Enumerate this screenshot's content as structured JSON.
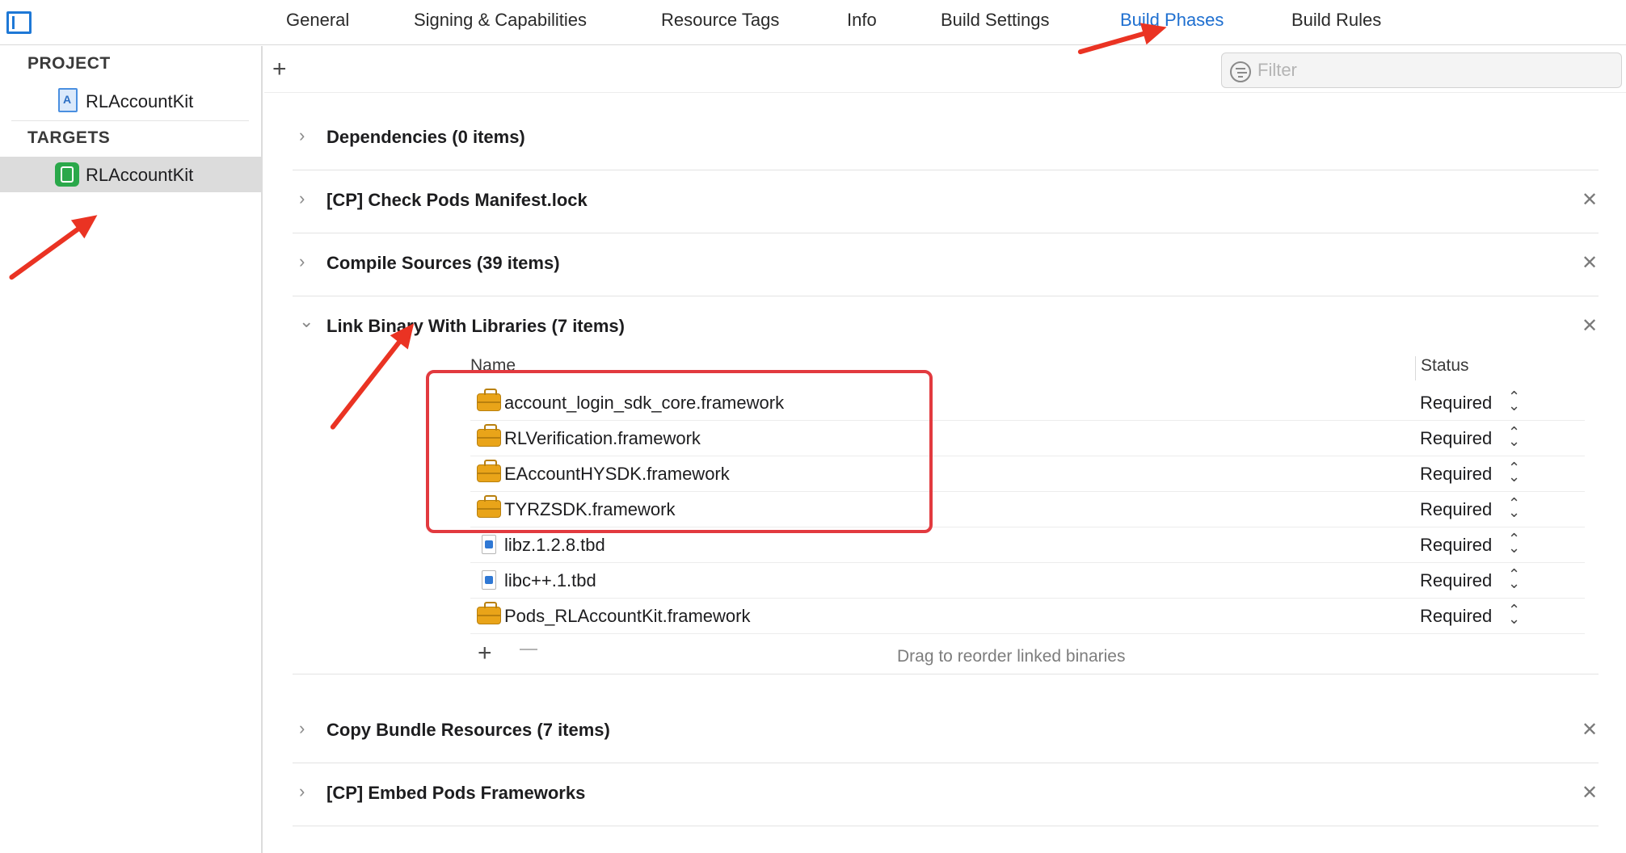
{
  "tabs": [
    {
      "label": "General",
      "active": false
    },
    {
      "label": "Signing & Capabilities",
      "active": false
    },
    {
      "label": "Resource Tags",
      "active": false
    },
    {
      "label": "Info",
      "active": false
    },
    {
      "label": "Build Settings",
      "active": false
    },
    {
      "label": "Build Phases",
      "active": true
    },
    {
      "label": "Build Rules",
      "active": false
    }
  ],
  "sidebar": {
    "project_header": "PROJECT",
    "project_item": "RLAccountKit",
    "targets_header": "TARGETS",
    "target_item": "RLAccountKit"
  },
  "toolbar": {
    "add_symbol": "+",
    "filter_placeholder": "Filter"
  },
  "phases": [
    {
      "title": "Dependencies (0 items)",
      "expanded": false,
      "removable": false
    },
    {
      "title": "[CP] Check Pods Manifest.lock",
      "expanded": false,
      "removable": true
    },
    {
      "title": "Compile Sources (39 items)",
      "expanded": false,
      "removable": true
    },
    {
      "title": "Link Binary With Libraries (7 items)",
      "expanded": true,
      "removable": true
    },
    {
      "title": "Copy Bundle Resources (7 items)",
      "expanded": false,
      "removable": true
    },
    {
      "title": "[CP] Embed Pods Frameworks",
      "expanded": false,
      "removable": true
    }
  ],
  "libraries": {
    "col_name": "Name",
    "col_status": "Status",
    "rows": [
      {
        "name": "account_login_sdk_core.framework",
        "status": "Required",
        "icon": "framework-icon"
      },
      {
        "name": "RLVerification.framework",
        "status": "Required",
        "icon": "framework-icon"
      },
      {
        "name": "EAccountHYSDK.framework",
        "status": "Required",
        "icon": "framework-icon"
      },
      {
        "name": "TYRZSDK.framework",
        "status": "Required",
        "icon": "framework-icon"
      },
      {
        "name": "libz.1.2.8.tbd",
        "status": "Required",
        "icon": "tbd-file-icon"
      },
      {
        "name": "libc++.1.tbd",
        "status": "Required",
        "icon": "tbd-file-icon"
      },
      {
        "name": "Pods_RLAccountKit.framework",
        "status": "Required",
        "icon": "framework-icon"
      }
    ],
    "add_symbol": "+",
    "hint": "Drag to reorder linked binaries"
  },
  "icons": {
    "collapsed": "›",
    "expanded": "⌄",
    "close": "✕",
    "stepper": "⌃⌄"
  },
  "colors": {
    "accent": "#1e6fd0",
    "annotation": "#ea3323",
    "selected_row": "#dcdcdc",
    "framework": "#e9a419"
  }
}
